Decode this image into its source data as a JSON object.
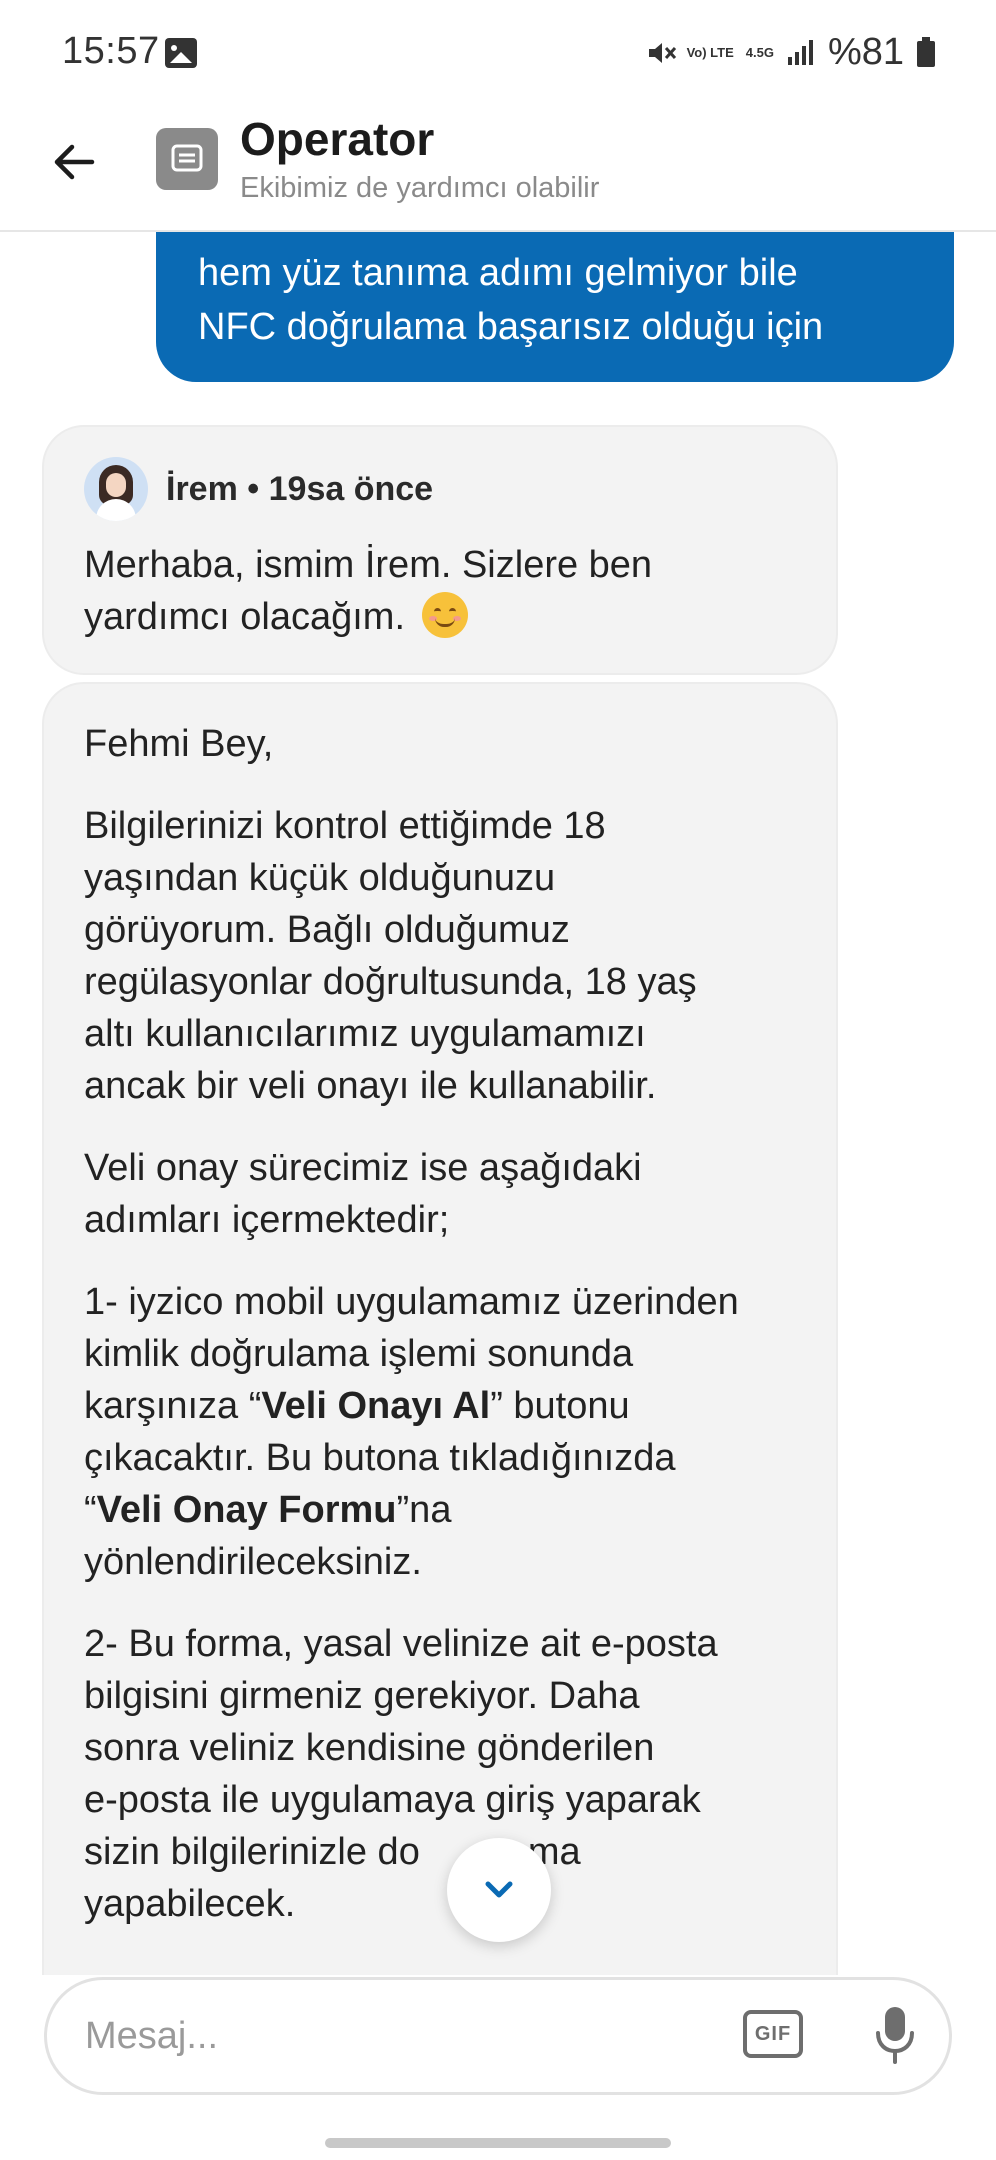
{
  "status_bar": {
    "time": "15:57",
    "network_volte": "Vo) LTE",
    "network_type": "4.5G",
    "battery_text": "%81",
    "icons": [
      "gallery-icon",
      "mute-icon",
      "signal-icon",
      "battery-icon"
    ]
  },
  "header": {
    "title": "Operator",
    "subtitle": "Ekibimiz de yardımcı olabilir"
  },
  "messages": {
    "outgoing": {
      "lines": [
        "hem yüz tanıma adımı gelmiyor bile",
        "NFC doğrulama başarısız olduğu için"
      ]
    },
    "incoming_1": {
      "sender": "İrem",
      "separator": "•",
      "time": "19sa önce",
      "lines": [
        "Merhaba, ismim İrem. Sizlere ben",
        "yardımcı olacağım."
      ]
    },
    "incoming_2": {
      "greeting": "Fehmi Bey,",
      "para1": [
        "Bilgilerinizi kontrol ettiğimde 18",
        "yaşından küçük olduğunuzu",
        "görüyorum. Bağlı olduğumuz",
        "regülasyonlar doğrultusunda, 18 yaş",
        "altı kullanıcılarımız uygulamamızı",
        "ancak bir veli onayı ile kullanabilir."
      ],
      "para2": [
        "Veli onay sürecimiz ise aşağıdaki",
        "adımları içermektedir;"
      ],
      "para3": {
        "line1": "1- iyzico mobil uygulamamız üzerinden",
        "line2": "kimlik doğrulama işlemi sonunda",
        "line3_pre": "karşınıza “",
        "line3_bold": "Veli Onayı Al",
        "line3_post": "” butonu",
        "line4": "çıkacaktır. Bu butona tıkladığınızda",
        "line5_pre": "“",
        "line5_bold": "Veli Onay Formu",
        "line5_post": "”na",
        "line6": "yönlendirileceksiniz."
      },
      "para4": [
        "2- Bu forma, yasal velinize ait e-posta",
        "bilgisini girmeniz gerekiyor. Daha",
        "sonra veliniz kendisine gönderilen",
        "e-posta ile uygulamaya giriş yaparak",
        "sizin bilgilerinizle do",
        "yapabilecek."
      ],
      "para4_line5_tail": "ma"
    }
  },
  "composer": {
    "placeholder": "Mesaj...",
    "gif_label": "GIF"
  },
  "colors": {
    "accent": "#0a6ab4",
    "incoming_bubble": "#f3f3f3",
    "header_icon": "#8a8a8a"
  }
}
